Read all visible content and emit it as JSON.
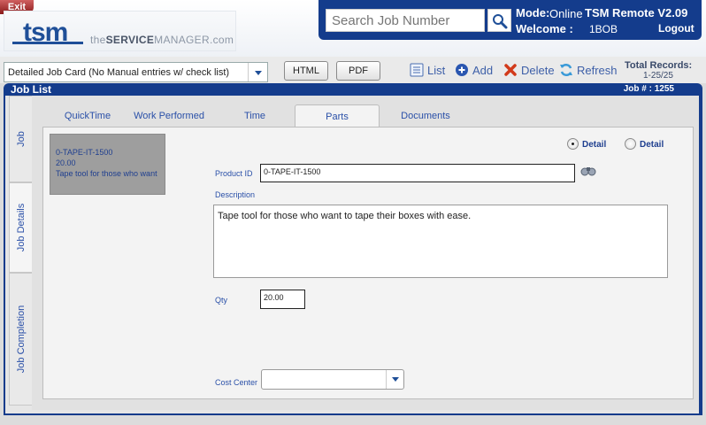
{
  "header": {
    "exit_label": "Exit",
    "logo_text": "tsm",
    "logo_sub_prefix": "the",
    "logo_sub_bold": "SERVICE",
    "logo_sub_suffix": "MANAGER.com",
    "search_placeholder": "Search Job Number",
    "mode_label": "Mode:",
    "mode_value": "Online",
    "app_version": "TSM Remote V2.09",
    "welcome_label": "Welcome :",
    "welcome_user": "1BOB",
    "logout_label": "Logout"
  },
  "toolbar": {
    "report_select": "Detailed Job Card (No Manual entries w/ check list)",
    "html_label": "HTML",
    "pdf_label": "PDF",
    "list_label": "List",
    "add_label": "Add",
    "delete_label": "Delete",
    "refresh_label": "Refresh",
    "total_label": "Total Records:",
    "total_value": "1-25/25"
  },
  "joblist": {
    "title": "Job List",
    "job_number": "Job # :  1255"
  },
  "side_tabs": [
    "Job",
    "Job Details",
    "Job Completion"
  ],
  "tabs": [
    "QuickTime",
    "Work Performed",
    "Time",
    "Parts",
    "Documents"
  ],
  "parts": {
    "preview": [
      "0-TAPE-IT-1500",
      "20.00",
      "Tape tool for those who want to tape their boxes with ease."
    ],
    "radio_1": "Detail",
    "radio_2": "Detail",
    "product_id_label": "Product ID",
    "product_id": "0-TAPE-IT-1500",
    "description_label": "Description",
    "description": "Tape tool for those who want to tape their boxes with ease.",
    "qty_label": "Qty",
    "qty": "20.00",
    "cost_center_label": "Cost Center",
    "cost_center": ""
  },
  "colors": {
    "brand_blue": "#143c8c",
    "exit_red": "#8a1a1a",
    "link_blue": "#2a50a8"
  }
}
